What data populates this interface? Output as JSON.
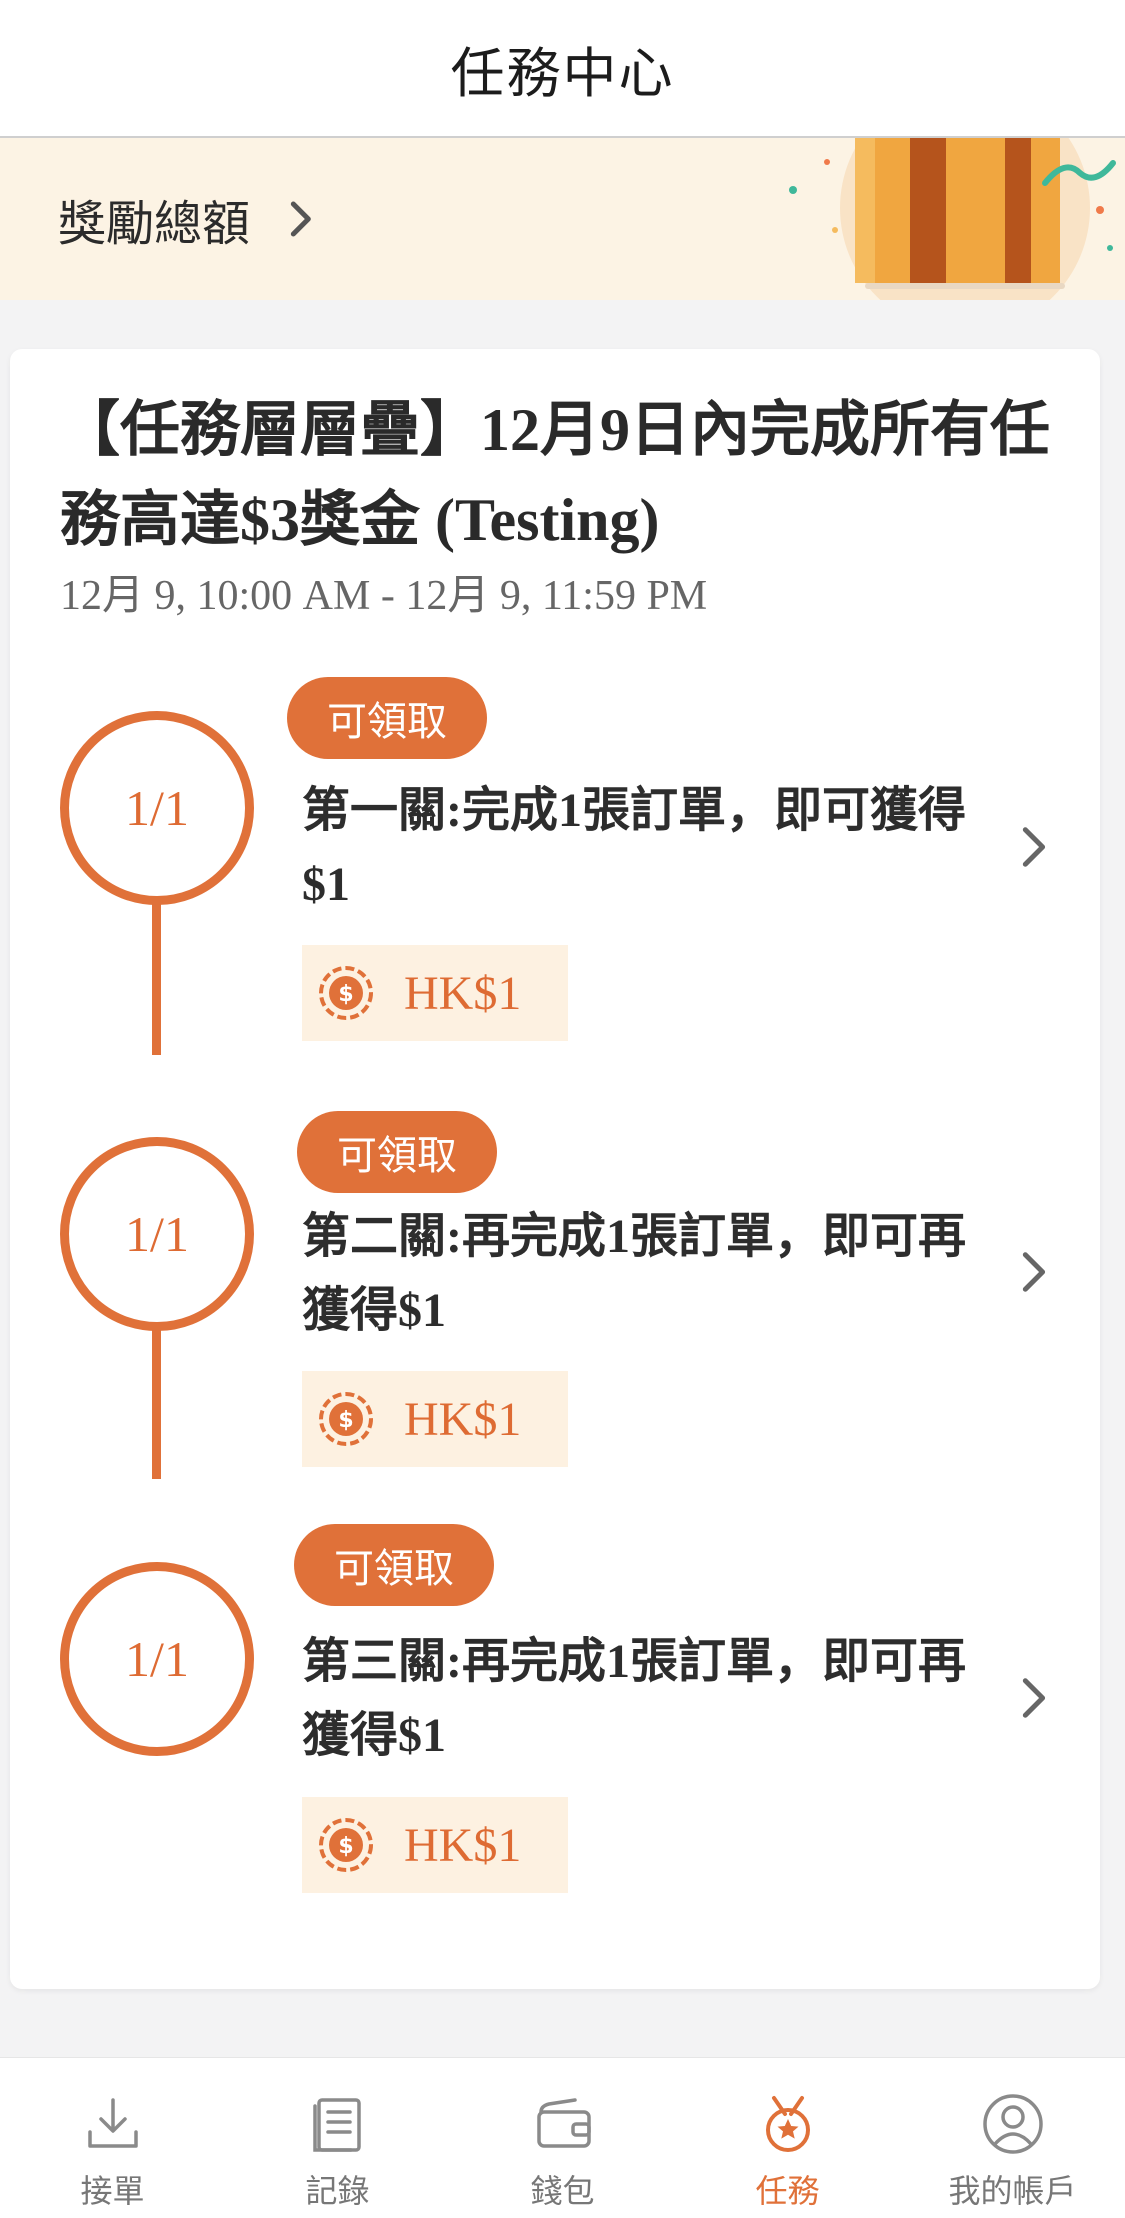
{
  "header": {
    "title": "任務中心"
  },
  "reward_banner": {
    "label": "獎勵總額"
  },
  "task": {
    "title": "【任務層層疊】12月9日內完成所有任務高達$3獎金 (Testing)",
    "date_range": "12月 9, 10:00 AM - 12月 9, 11:59 PM",
    "levels": [
      {
        "progress": "1/1",
        "badge": "可領取",
        "description": "第一關:完成1張訂單，即可獲得$1",
        "reward": "HK$1"
      },
      {
        "progress": "1/1",
        "badge": "可領取",
        "description": "第二關:再完成1張訂單，即可再獲得$1",
        "reward": "HK$1"
      },
      {
        "progress": "1/1",
        "badge": "可領取",
        "description": "第三關:再完成1張訂單，即可再獲得$1",
        "reward": "HK$1"
      }
    ]
  },
  "tabbar": {
    "tabs": [
      {
        "label": "接單",
        "icon": "download-icon",
        "active": false
      },
      {
        "label": "記錄",
        "icon": "document-icon",
        "active": false
      },
      {
        "label": "錢包",
        "icon": "wallet-icon",
        "active": false
      },
      {
        "label": "任務",
        "icon": "medal-icon",
        "active": true
      },
      {
        "label": "我的帳戶",
        "icon": "user-icon",
        "active": false
      }
    ]
  },
  "colors": {
    "accent": "#e07139",
    "banner_bg": "#fcf3e4",
    "chip_bg": "#fdf1e1",
    "page_bg": "#f3f3f4"
  }
}
